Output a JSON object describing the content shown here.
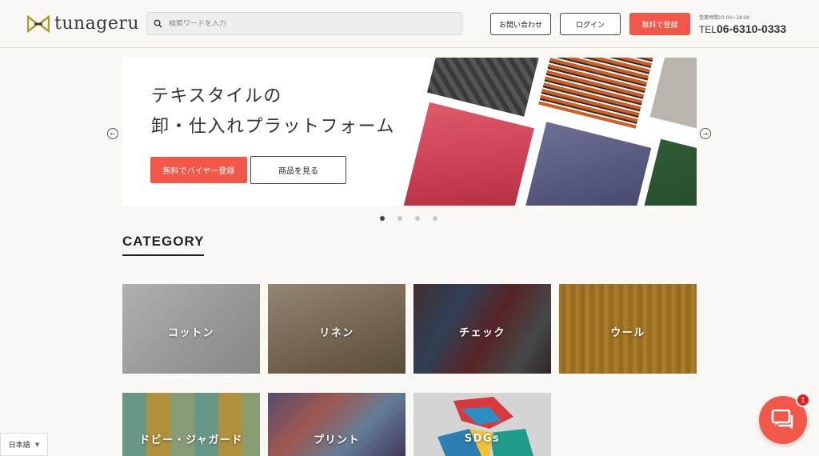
{
  "header": {
    "logo_text": "tunageru",
    "search_placeholder": "検索ワードを入力",
    "contact_label": "お問い合わせ",
    "login_label": "ログイン",
    "register_label": "無料で登録",
    "business_hours": "営業時間10:00~18:00",
    "tel_prefix": "TEL",
    "tel_number": "06-6310-0333"
  },
  "hero": {
    "title_line1": "テキスタイルの",
    "title_line2": "卸・仕入れプラットフォーム",
    "buyer_button": "無料でバイヤー登録",
    "products_button": "商品を見る",
    "slide_count": 4,
    "active_slide": 0
  },
  "category": {
    "heading": "CATEGORY",
    "items": [
      {
        "label": "コットン"
      },
      {
        "label": "リネン"
      },
      {
        "label": "チェック"
      },
      {
        "label": "ウール"
      },
      {
        "label": "ドビー・ジャガード"
      },
      {
        "label": "プリント"
      },
      {
        "label": "SDGs"
      }
    ]
  },
  "language": {
    "selected": "日本語"
  },
  "chat": {
    "badge_count": "1"
  },
  "colors": {
    "accent": "#f2584a",
    "background": "#faf8f5"
  }
}
